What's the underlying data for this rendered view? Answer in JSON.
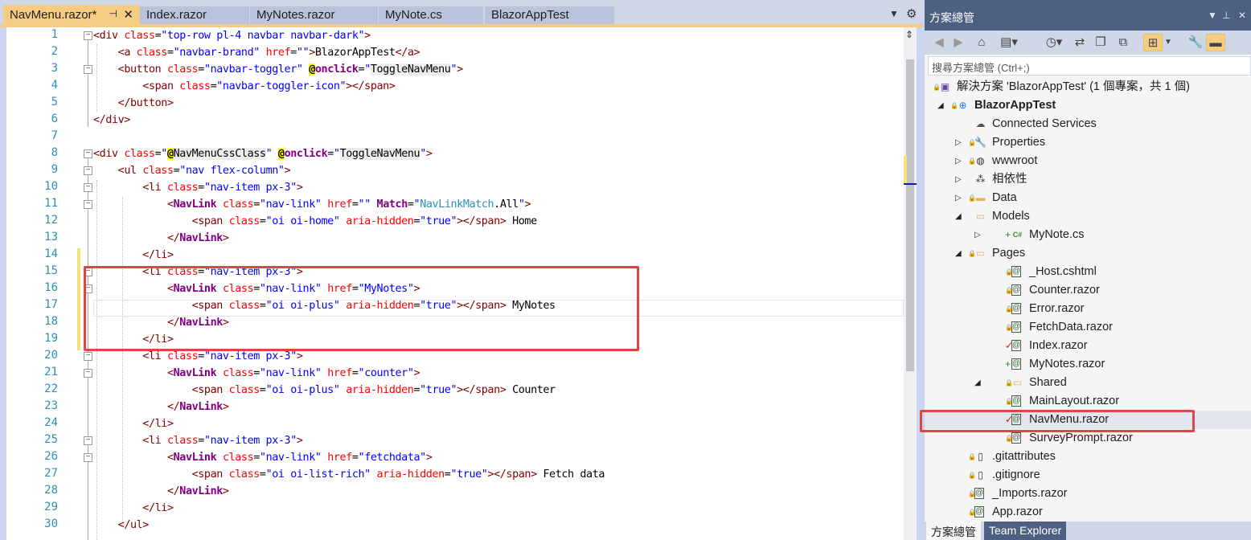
{
  "tabs": [
    {
      "label": "NavMenu.razor*",
      "active": true
    },
    {
      "label": "Index.razor",
      "active": false
    },
    {
      "label": "MyNotes.razor",
      "active": false
    },
    {
      "label": "MyNote.cs",
      "active": false
    },
    {
      "label": "BlazorAppTest",
      "active": false
    }
  ],
  "tab_controls": {
    "dropdown_icon": "chevron-down-icon",
    "settings_icon": "gear-icon",
    "pin_icon": "pin-icon",
    "close_icon": "close-icon"
  },
  "editor": {
    "line_numbers": [
      "1",
      "2",
      "3",
      "4",
      "5",
      "6",
      "7",
      "8",
      "9",
      "10",
      "11",
      "12",
      "13",
      "14",
      "15",
      "16",
      "17",
      "18",
      "19",
      "20",
      "21",
      "22",
      "23",
      "24",
      "25",
      "26",
      "27",
      "28",
      "29",
      "30"
    ],
    "lines": [
      [
        [
          "tag",
          "<div "
        ],
        [
          "attr",
          "class"
        ],
        [
          "plain",
          "="
        ],
        [
          "val",
          "\"top-row pl-4 navbar navbar-dark\""
        ],
        [
          "tag",
          ">"
        ]
      ],
      [
        [
          "plain",
          "    "
        ],
        [
          "tag",
          "<a "
        ],
        [
          "attr",
          "class"
        ],
        [
          "plain",
          "="
        ],
        [
          "val",
          "\"navbar-brand\""
        ],
        [
          "plain",
          " "
        ],
        [
          "attr",
          "href"
        ],
        [
          "plain",
          "="
        ],
        [
          "val",
          "\"\""
        ],
        [
          "tag",
          ">"
        ],
        [
          "plain",
          "BlazorAppTest"
        ],
        [
          "tag",
          "</a>"
        ]
      ],
      [
        [
          "plain",
          "    "
        ],
        [
          "tag",
          "<button "
        ],
        [
          "attr",
          "class"
        ],
        [
          "plain",
          "="
        ],
        [
          "val",
          "\"navbar-toggler\""
        ],
        [
          "plain",
          " "
        ],
        [
          "at",
          "@"
        ],
        [
          "dir",
          "onclick"
        ],
        [
          "plain",
          "="
        ],
        [
          "val",
          "\""
        ],
        [
          "expr",
          "ToggleNavMenu"
        ],
        [
          "val",
          "\""
        ],
        [
          "tag",
          ">"
        ]
      ],
      [
        [
          "plain",
          "        "
        ],
        [
          "tag",
          "<span "
        ],
        [
          "attr",
          "class"
        ],
        [
          "plain",
          "="
        ],
        [
          "val",
          "\"navbar-toggler-icon\""
        ],
        [
          "tag",
          "></span>"
        ]
      ],
      [
        [
          "plain",
          "    "
        ],
        [
          "tag",
          "</button>"
        ]
      ],
      [
        [
          "tag",
          "</div>"
        ]
      ],
      [],
      [
        [
          "tag",
          "<div "
        ],
        [
          "attr",
          "class"
        ],
        [
          "plain",
          "="
        ],
        [
          "val",
          "\""
        ],
        [
          "at",
          "@"
        ],
        [
          "expr",
          "NavMenuCssClass"
        ],
        [
          "val",
          "\""
        ],
        [
          "plain",
          " "
        ],
        [
          "at",
          "@"
        ],
        [
          "dir",
          "onclick"
        ],
        [
          "plain",
          "="
        ],
        [
          "val",
          "\""
        ],
        [
          "expr",
          "ToggleNavMenu"
        ],
        [
          "val",
          "\""
        ],
        [
          "tag",
          ">"
        ]
      ],
      [
        [
          "plain",
          "    "
        ],
        [
          "tag",
          "<ul "
        ],
        [
          "attr",
          "class"
        ],
        [
          "plain",
          "="
        ],
        [
          "val",
          "\"nav flex-column\""
        ],
        [
          "tag",
          ">"
        ]
      ],
      [
        [
          "plain",
          "        "
        ],
        [
          "tag",
          "<li "
        ],
        [
          "attr",
          "class"
        ],
        [
          "plain",
          "="
        ],
        [
          "val",
          "\"nav-item px-3\""
        ],
        [
          "tag",
          ">"
        ]
      ],
      [
        [
          "plain",
          "            "
        ],
        [
          "tag",
          "<"
        ],
        [
          "comp",
          "NavLink"
        ],
        [
          "plain",
          " "
        ],
        [
          "attr",
          "class"
        ],
        [
          "plain",
          "="
        ],
        [
          "val",
          "\"nav-link\""
        ],
        [
          "plain",
          " "
        ],
        [
          "attr",
          "href"
        ],
        [
          "plain",
          "="
        ],
        [
          "val",
          "\"\""
        ],
        [
          "plain",
          " "
        ],
        [
          "comp",
          "Match"
        ],
        [
          "plain",
          "="
        ],
        [
          "val",
          "\""
        ],
        [
          "type",
          "NavLinkMatch"
        ],
        [
          "plain",
          ".All"
        ],
        [
          "val",
          "\""
        ],
        [
          "tag",
          ">"
        ]
      ],
      [
        [
          "plain",
          "                "
        ],
        [
          "tag",
          "<span "
        ],
        [
          "attr",
          "class"
        ],
        [
          "plain",
          "="
        ],
        [
          "val",
          "\"oi oi-home\""
        ],
        [
          "plain",
          " "
        ],
        [
          "attr",
          "aria-hidden"
        ],
        [
          "plain",
          "="
        ],
        [
          "val",
          "\"true\""
        ],
        [
          "tag",
          "></span>"
        ],
        [
          "plain",
          " Home"
        ]
      ],
      [
        [
          "plain",
          "            "
        ],
        [
          "tag",
          "</"
        ],
        [
          "comp",
          "NavLink"
        ],
        [
          "tag",
          ">"
        ]
      ],
      [
        [
          "plain",
          "        "
        ],
        [
          "tag",
          "</li>"
        ]
      ],
      [
        [
          "plain",
          "        "
        ],
        [
          "tag",
          "<li "
        ],
        [
          "attr",
          "class"
        ],
        [
          "plain",
          "="
        ],
        [
          "val",
          "\"nav-item px-3\""
        ],
        [
          "tag",
          ">"
        ]
      ],
      [
        [
          "plain",
          "            "
        ],
        [
          "tag",
          "<"
        ],
        [
          "comp",
          "NavLink"
        ],
        [
          "plain",
          " "
        ],
        [
          "attr",
          "class"
        ],
        [
          "plain",
          "="
        ],
        [
          "val",
          "\"nav-link\""
        ],
        [
          "plain",
          " "
        ],
        [
          "attr",
          "href"
        ],
        [
          "plain",
          "="
        ],
        [
          "val",
          "\"MyNotes\""
        ],
        [
          "tag",
          ">"
        ]
      ],
      [
        [
          "plain",
          "                "
        ],
        [
          "tag",
          "<span "
        ],
        [
          "attr",
          "class"
        ],
        [
          "plain",
          "="
        ],
        [
          "val",
          "\"oi oi-plus\""
        ],
        [
          "plain",
          " "
        ],
        [
          "attr",
          "aria-hidden"
        ],
        [
          "plain",
          "="
        ],
        [
          "val",
          "\"true\""
        ],
        [
          "tag",
          "></span>"
        ],
        [
          "plain",
          " MyNotes"
        ]
      ],
      [
        [
          "plain",
          "            "
        ],
        [
          "tag",
          "</"
        ],
        [
          "comp",
          "NavLink"
        ],
        [
          "tag",
          ">"
        ]
      ],
      [
        [
          "plain",
          "        "
        ],
        [
          "tag",
          "</li>"
        ]
      ],
      [
        [
          "plain",
          "        "
        ],
        [
          "tag",
          "<li "
        ],
        [
          "attr",
          "class"
        ],
        [
          "plain",
          "="
        ],
        [
          "val",
          "\"nav-item px-3\""
        ],
        [
          "tag",
          ">"
        ]
      ],
      [
        [
          "plain",
          "            "
        ],
        [
          "tag",
          "<"
        ],
        [
          "comp",
          "NavLink"
        ],
        [
          "plain",
          " "
        ],
        [
          "attr",
          "class"
        ],
        [
          "plain",
          "="
        ],
        [
          "val",
          "\"nav-link\""
        ],
        [
          "plain",
          " "
        ],
        [
          "attr",
          "href"
        ],
        [
          "plain",
          "="
        ],
        [
          "val",
          "\"counter\""
        ],
        [
          "tag",
          ">"
        ]
      ],
      [
        [
          "plain",
          "                "
        ],
        [
          "tag",
          "<span "
        ],
        [
          "attr",
          "class"
        ],
        [
          "plain",
          "="
        ],
        [
          "val",
          "\"oi oi-plus\""
        ],
        [
          "plain",
          " "
        ],
        [
          "attr",
          "aria-hidden"
        ],
        [
          "plain",
          "="
        ],
        [
          "val",
          "\"true\""
        ],
        [
          "tag",
          "></span>"
        ],
        [
          "plain",
          " Counter"
        ]
      ],
      [
        [
          "plain",
          "            "
        ],
        [
          "tag",
          "</"
        ],
        [
          "comp",
          "NavLink"
        ],
        [
          "tag",
          ">"
        ]
      ],
      [
        [
          "plain",
          "        "
        ],
        [
          "tag",
          "</li>"
        ]
      ],
      [
        [
          "plain",
          "        "
        ],
        [
          "tag",
          "<li "
        ],
        [
          "attr",
          "class"
        ],
        [
          "plain",
          "="
        ],
        [
          "val",
          "\"nav-item px-3\""
        ],
        [
          "tag",
          ">"
        ]
      ],
      [
        [
          "plain",
          "            "
        ],
        [
          "tag",
          "<"
        ],
        [
          "comp",
          "NavLink"
        ],
        [
          "plain",
          " "
        ],
        [
          "attr",
          "class"
        ],
        [
          "plain",
          "="
        ],
        [
          "val",
          "\"nav-link\""
        ],
        [
          "plain",
          " "
        ],
        [
          "attr",
          "href"
        ],
        [
          "plain",
          "="
        ],
        [
          "val",
          "\"fetchdata\""
        ],
        [
          "tag",
          ">"
        ]
      ],
      [
        [
          "plain",
          "                "
        ],
        [
          "tag",
          "<span "
        ],
        [
          "attr",
          "class"
        ],
        [
          "plain",
          "="
        ],
        [
          "val",
          "\"oi oi-list-rich\""
        ],
        [
          "plain",
          " "
        ],
        [
          "attr",
          "aria-hidden"
        ],
        [
          "plain",
          "="
        ],
        [
          "val",
          "\"true\""
        ],
        [
          "tag",
          "></span>"
        ],
        [
          "plain",
          " Fetch data"
        ]
      ],
      [
        [
          "plain",
          "            "
        ],
        [
          "tag",
          "</"
        ],
        [
          "comp",
          "NavLink"
        ],
        [
          "tag",
          ">"
        ]
      ],
      [
        [
          "plain",
          "        "
        ],
        [
          "tag",
          "</li>"
        ]
      ],
      [
        [
          "plain",
          "    "
        ],
        [
          "tag",
          "</ul>"
        ]
      ]
    ]
  },
  "solution_explorer": {
    "title": "方案總管",
    "search_placeholder": "搜尋方案總管 (Ctrl+;)",
    "toolbar_icons": [
      "back-icon",
      "forward-icon",
      "home-icon",
      "switch-views-icon",
      "history-icon",
      "sync-icon",
      "collapse-all-icon",
      "show-all-files-icon",
      "track-active-icon",
      "properties-wrench-icon",
      "preview-icon"
    ],
    "items": [
      {
        "label": "解決方案 'BlazorAppTest' (1 個專案，共 1 個)",
        "icon": "solution-icon",
        "bold": false,
        "arrow": "",
        "lock": true
      },
      {
        "label": "BlazorAppTest",
        "icon": "web-project-icon",
        "bold": true,
        "arrow": "expanded",
        "lock": true
      },
      {
        "label": "Connected Services",
        "icon": "cloud-icon",
        "bold": false,
        "arrow": "",
        "lock": false
      },
      {
        "label": "Properties",
        "icon": "wrench-icon",
        "bold": false,
        "arrow": "collapsed",
        "lock": true
      },
      {
        "label": "wwwroot",
        "icon": "globe-icon",
        "bold": false,
        "arrow": "collapsed",
        "lock": true
      },
      {
        "label": "相依性",
        "icon": "dependencies-icon",
        "bold": false,
        "arrow": "collapsed",
        "lock": false
      },
      {
        "label": "Data",
        "icon": "folder-icon",
        "bold": false,
        "arrow": "collapsed",
        "lock": true
      },
      {
        "label": "Models",
        "icon": "folder-open-icon",
        "bold": false,
        "arrow": "expanded",
        "lock": false
      },
      {
        "label": "MyNote.cs",
        "icon": "csharp-file-icon",
        "bold": false,
        "arrow": "collapsed",
        "lock": false,
        "status": "+"
      },
      {
        "label": "Pages",
        "icon": "folder-open-icon",
        "bold": false,
        "arrow": "expanded",
        "lock": true
      },
      {
        "label": "_Host.cshtml",
        "icon": "razor-file-icon",
        "bold": false,
        "arrow": "",
        "lock": true
      },
      {
        "label": "Counter.razor",
        "icon": "razor-file-icon",
        "bold": false,
        "arrow": "",
        "lock": true
      },
      {
        "label": "Error.razor",
        "icon": "razor-file-icon",
        "bold": false,
        "arrow": "",
        "lock": true
      },
      {
        "label": "FetchData.razor",
        "icon": "razor-file-icon",
        "bold": false,
        "arrow": "",
        "lock": true
      },
      {
        "label": "Index.razor",
        "icon": "razor-file-icon",
        "bold": false,
        "arrow": "",
        "lock": false,
        "status": "✓"
      },
      {
        "label": "MyNotes.razor",
        "icon": "razor-file-icon",
        "bold": false,
        "arrow": "",
        "lock": false,
        "status": "+"
      },
      {
        "label": "Shared",
        "icon": "folder-open-icon",
        "bold": false,
        "arrow": "expanded",
        "lock": true
      },
      {
        "label": "MainLayout.razor",
        "icon": "razor-file-icon",
        "bold": false,
        "arrow": "",
        "lock": true
      },
      {
        "label": "NavMenu.razor",
        "icon": "razor-file-icon",
        "bold": false,
        "arrow": "",
        "lock": false,
        "status": "✓",
        "selected": true
      },
      {
        "label": "SurveyPrompt.razor",
        "icon": "razor-file-icon",
        "bold": false,
        "arrow": "",
        "lock": true
      },
      {
        "label": ".gitattributes",
        "icon": "file-icon",
        "bold": false,
        "arrow": "",
        "lock": true
      },
      {
        "label": ".gitignore",
        "icon": "file-icon",
        "bold": false,
        "arrow": "",
        "lock": true
      },
      {
        "label": "_Imports.razor",
        "icon": "razor-file-icon",
        "bold": false,
        "arrow": "",
        "lock": true
      },
      {
        "label": "App.razor",
        "icon": "razor-file-icon",
        "bold": false,
        "arrow": "",
        "lock": true
      }
    ],
    "bottom_tabs": [
      {
        "label": "方案總管",
        "active": true
      },
      {
        "label": "Team Explorer",
        "active": false
      }
    ]
  },
  "colors": {
    "accent": "#f5cc84",
    "title_bar": "#4d6082",
    "highlight_box": "#e04545",
    "line_number": "#2b91af"
  }
}
